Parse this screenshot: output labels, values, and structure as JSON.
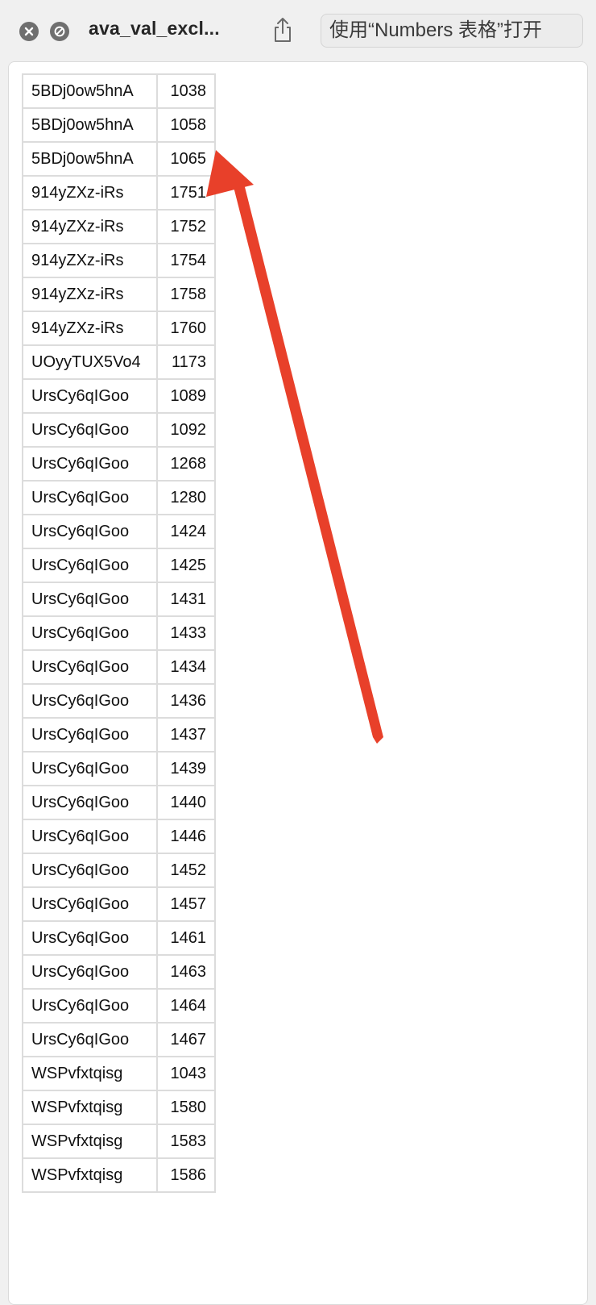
{
  "window": {
    "title": "ava_val_excl...",
    "open_with_label": "使用“Numbers 表格”打开"
  },
  "icons": {
    "close": "close-icon",
    "block": "block-icon",
    "share": "share-icon"
  },
  "annotation": {
    "color": "#e8402a",
    "shape": "arrow"
  },
  "table": {
    "rows": [
      {
        "id": "5BDj0ow5hnA",
        "value": "1038"
      },
      {
        "id": "5BDj0ow5hnA",
        "value": "1058"
      },
      {
        "id": "5BDj0ow5hnA",
        "value": "1065"
      },
      {
        "id": "914yZXz-iRs",
        "value": "1751"
      },
      {
        "id": "914yZXz-iRs",
        "value": "1752"
      },
      {
        "id": "914yZXz-iRs",
        "value": "1754"
      },
      {
        "id": "914yZXz-iRs",
        "value": "1758"
      },
      {
        "id": "914yZXz-iRs",
        "value": "1760"
      },
      {
        "id": "UOyyTUX5Vo4",
        "value": "1173"
      },
      {
        "id": "UrsCy6qIGoo",
        "value": "1089"
      },
      {
        "id": "UrsCy6qIGoo",
        "value": "1092"
      },
      {
        "id": "UrsCy6qIGoo",
        "value": "1268"
      },
      {
        "id": "UrsCy6qIGoo",
        "value": "1280"
      },
      {
        "id": "UrsCy6qIGoo",
        "value": "1424"
      },
      {
        "id": "UrsCy6qIGoo",
        "value": "1425"
      },
      {
        "id": "UrsCy6qIGoo",
        "value": "1431"
      },
      {
        "id": "UrsCy6qIGoo",
        "value": "1433"
      },
      {
        "id": "UrsCy6qIGoo",
        "value": "1434"
      },
      {
        "id": "UrsCy6qIGoo",
        "value": "1436"
      },
      {
        "id": "UrsCy6qIGoo",
        "value": "1437"
      },
      {
        "id": "UrsCy6qIGoo",
        "value": "1439"
      },
      {
        "id": "UrsCy6qIGoo",
        "value": "1440"
      },
      {
        "id": "UrsCy6qIGoo",
        "value": "1446"
      },
      {
        "id": "UrsCy6qIGoo",
        "value": "1452"
      },
      {
        "id": "UrsCy6qIGoo",
        "value": "1457"
      },
      {
        "id": "UrsCy6qIGoo",
        "value": "1461"
      },
      {
        "id": "UrsCy6qIGoo",
        "value": "1463"
      },
      {
        "id": "UrsCy6qIGoo",
        "value": "1464"
      },
      {
        "id": "UrsCy6qIGoo",
        "value": "1467"
      },
      {
        "id": "WSPvfxtqisg",
        "value": "1043"
      },
      {
        "id": "WSPvfxtqisg",
        "value": "1580"
      },
      {
        "id": "WSPvfxtqisg",
        "value": "1583"
      },
      {
        "id": "WSPvfxtqisg",
        "value": "1586"
      }
    ]
  }
}
